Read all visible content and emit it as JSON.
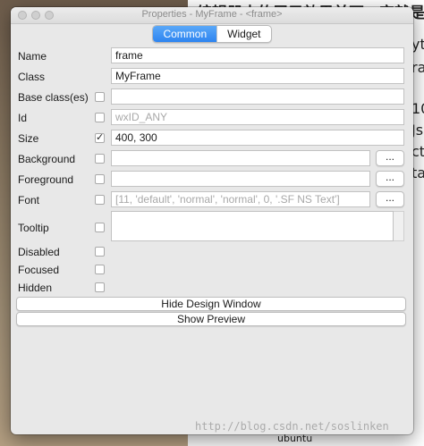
{
  "window": {
    "title": "Properties - MyFrame - <frame>"
  },
  "background": {
    "top_text": "编辑器中的展示效果并不一定就是",
    "right_fragments": [
      "yt",
      "ra",
      "10",
      "Js",
      "ct",
      "ta"
    ],
    "bottom_text": "ubuntu"
  },
  "tabs": [
    {
      "label": "Common",
      "active": true
    },
    {
      "label": "Widget",
      "active": false
    }
  ],
  "properties": {
    "name": {
      "label": "Name",
      "value": "frame"
    },
    "class": {
      "label": "Class",
      "value": "MyFrame"
    },
    "base_classes": {
      "label": "Base class(es)",
      "value": "",
      "checked": false
    },
    "id": {
      "label": "Id",
      "value": "wxID_ANY",
      "checked": false
    },
    "size": {
      "label": "Size",
      "value": "400, 300",
      "checked": true
    },
    "background": {
      "label": "Background",
      "value": "",
      "checked": false,
      "button": "..."
    },
    "foreground": {
      "label": "Foreground",
      "value": "",
      "checked": false,
      "button": "..."
    },
    "font": {
      "label": "Font",
      "value": "[11, 'default', 'normal', 'normal', 0, '.SF NS Text']",
      "checked": false,
      "button": "..."
    },
    "tooltip": {
      "label": "Tooltip",
      "value": "",
      "checked": false
    },
    "disabled": {
      "label": "Disabled",
      "checked": false
    },
    "focused": {
      "label": "Focused",
      "checked": false
    },
    "hidden": {
      "label": "Hidden",
      "checked": false
    }
  },
  "buttons": {
    "hide_design": "Hide Design Window",
    "show_preview": "Show Preview"
  },
  "watermark": "http://blog.csdn.net/soslinken"
}
